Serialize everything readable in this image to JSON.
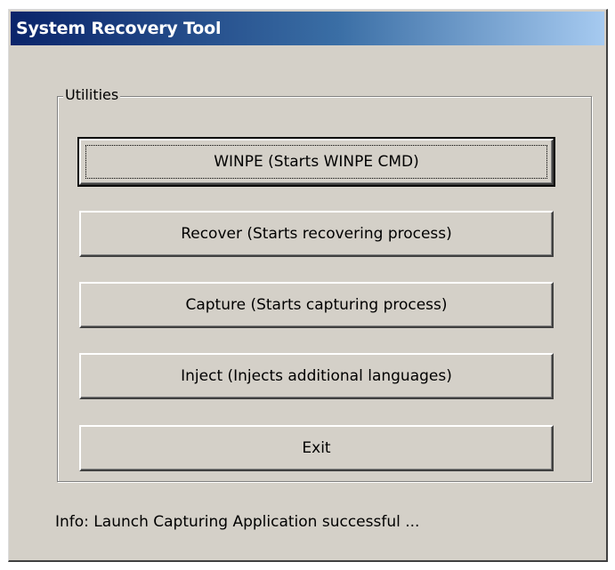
{
  "window": {
    "title": "System Recovery Tool"
  },
  "group": {
    "legend": "Utilities"
  },
  "buttons": {
    "winpe": "WINPE (Starts WINPE CMD)",
    "recover": "Recover (Starts recovering process)",
    "capture": "Capture (Starts capturing process)",
    "inject": "Inject (Injects additional languages)",
    "exit": "Exit"
  },
  "status": {
    "text": "Info: Launch Capturing Application successful ..."
  }
}
